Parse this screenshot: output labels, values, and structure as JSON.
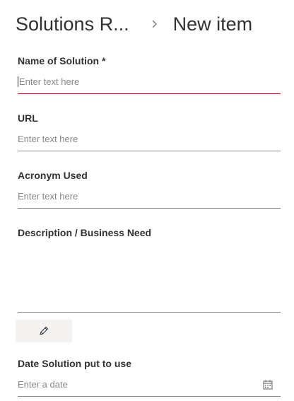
{
  "header": {
    "list_name": "Solutions R...",
    "separator_icon": "chevron-right-icon",
    "page_title": "New item"
  },
  "form": {
    "name": {
      "label": "Name of Solution *",
      "placeholder": "Enter text here",
      "value": ""
    },
    "url": {
      "label": "URL",
      "placeholder": "Enter text here",
      "value": ""
    },
    "acronym": {
      "label": "Acronym Used",
      "placeholder": "Enter text here",
      "value": ""
    },
    "description": {
      "label": "Description / Business Need",
      "value": "",
      "edit_icon": "pencil-icon"
    },
    "date": {
      "label": "Date Solution put to use",
      "placeholder": "Enter a date",
      "value": "",
      "icon": "calendar-icon"
    }
  },
  "colors": {
    "text": "#323130",
    "placeholder": "#8a8886",
    "error_underline": "#a4262c",
    "button_bg": "#f3f2f1"
  }
}
